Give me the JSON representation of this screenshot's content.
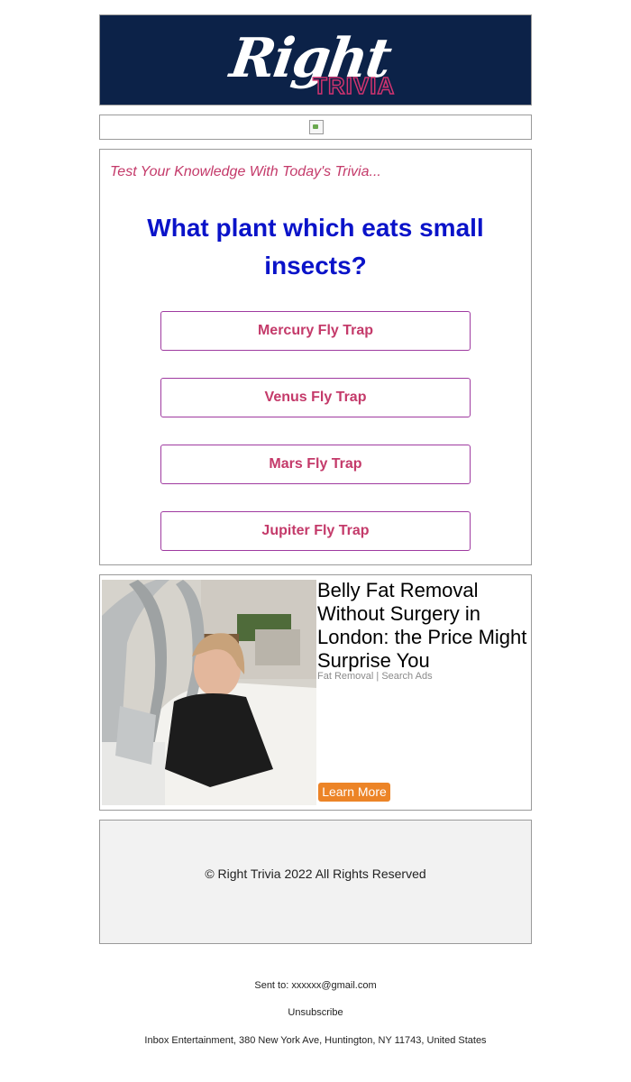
{
  "header": {
    "logo_main": "Right",
    "logo_sub": "TRIVIA"
  },
  "trivia": {
    "subtitle": "Test Your Knowledge With Today's Trivia...",
    "question": "What plant which eats small insects?",
    "answers": [
      {
        "label": "Mercury Fly Trap"
      },
      {
        "label": "Venus Fly Trap"
      },
      {
        "label": "Mars Fly Trap"
      },
      {
        "label": "Jupiter Fly Trap"
      }
    ]
  },
  "ad": {
    "title": "Belly Fat Removal Without Surgery in London: the Price Might Surprise You",
    "source": "Fat Removal | Search Ads",
    "button_label": "Learn More"
  },
  "footer": {
    "copyright": "© Right Trivia 2022 All Rights Reserved",
    "sent_to": "Sent to: xxxxxx@gmail.com",
    "unsubscribe": "Unsubscribe",
    "address": "Inbox Entertainment, 380 New York Ave, Huntington, NY 11743, United States"
  },
  "colors": {
    "header_bg": "#0c2248",
    "question": "#0a13c9",
    "accent_pink": "#c43a6a",
    "button_border": "#9f3aa0",
    "ad_button": "#ec8427",
    "footer_bg": "#f2f2f2"
  }
}
